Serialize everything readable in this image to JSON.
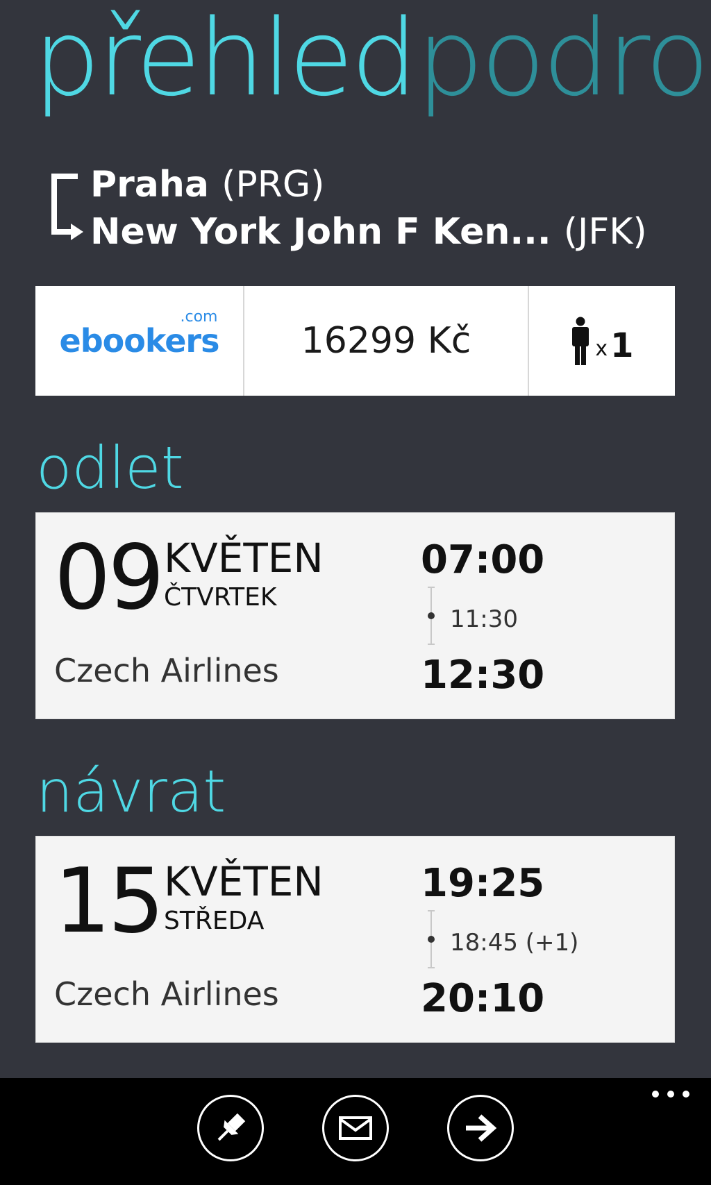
{
  "pivot": {
    "active": "přehled",
    "inactive": "podrob"
  },
  "route": {
    "from_city": "Praha",
    "from_code": "(PRG)",
    "to_city": "New York John F Ken...",
    "to_code": "(JFK)"
  },
  "summary": {
    "provider_logo": "ebookers",
    "provider_logo_suffix": ".com",
    "price": "16299 Kč",
    "passenger_icon": "person-icon",
    "passenger_multiplier": "x",
    "passenger_count": "1"
  },
  "departure": {
    "heading": "odlet",
    "day": "09",
    "month": "KVĚTEN",
    "weekday": "ČTVRTEK",
    "airline": "Czech Airlines",
    "departure_time": "07:00",
    "duration": "11:30",
    "arrival_time": "12:30"
  },
  "return": {
    "heading": "návrat",
    "day": "15",
    "month": "KVĚTEN",
    "weekday": "STŘEDA",
    "airline": "Czech Airlines",
    "departure_time": "19:25",
    "duration": "18:45 (+1)",
    "arrival_time": "20:10"
  },
  "appbar": {
    "buttons": [
      "pin-icon",
      "mail-icon",
      "arrow-right-icon"
    ],
    "more": "more-icon"
  },
  "colors": {
    "background": "#33353d",
    "accent": "#4fd8e4",
    "accent_dim": "#2e8f99",
    "provider_blue": "#2a8be6",
    "appbar": "#000000"
  }
}
